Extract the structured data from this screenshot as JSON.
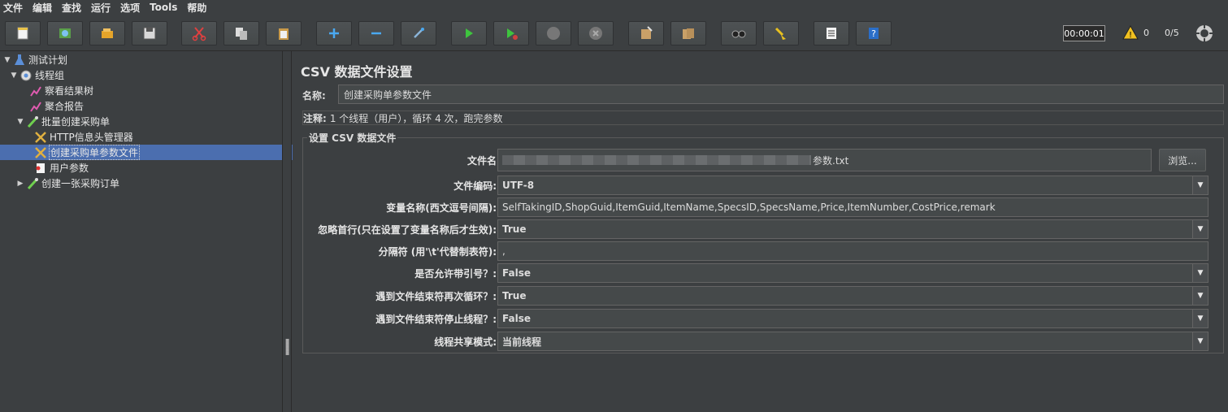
{
  "menu": [
    "文件",
    "编辑",
    "查找",
    "运行",
    "选项",
    "Tools",
    "帮助"
  ],
  "toolbar": {
    "buttons": [
      "new-icon",
      "templates-icon",
      "open-icon",
      "save-icon",
      "cut-icon",
      "copy-icon",
      "paste-icon",
      "expand-icon",
      "collapse-icon",
      "toggle-icon",
      "start-icon",
      "start-no-pause-icon",
      "stop-icon",
      "shutdown-icon",
      "clear-icon",
      "clear-all-icon",
      "search-icon",
      "reset-search-icon",
      "function-helper-icon",
      "help-icon"
    ],
    "timer": "00:00:01",
    "warnings": "0",
    "threads": "0/5"
  },
  "tree": [
    {
      "label": "测试计划",
      "icon": "test-plan-icon",
      "toggle": "▼"
    },
    {
      "label": "线程组",
      "icon": "thread-group-icon",
      "toggle": "▼"
    },
    {
      "label": "察看结果树",
      "icon": "listener-icon",
      "toggle": ""
    },
    {
      "label": "聚合报告",
      "icon": "listener-icon",
      "toggle": ""
    },
    {
      "label": "批量创建采购单",
      "icon": "sampler-icon",
      "toggle": "▼"
    },
    {
      "label": "HTTP信息头管理器",
      "icon": "config-icon",
      "toggle": ""
    },
    {
      "label": "创建采购单参数文件",
      "icon": "config-icon",
      "toggle": ""
    },
    {
      "label": "用户参数",
      "icon": "preprocessor-icon",
      "toggle": ""
    },
    {
      "label": "创建一张采购订单",
      "icon": "sampler-icon",
      "toggle": "▶"
    }
  ],
  "panel": {
    "title": "CSV 数据文件设置",
    "name_label": "名称:",
    "name_value": "创建采购单参数文件",
    "comment_label": "注释:",
    "comment_value": "1 个线程（用户），循环 4 次，跑完参数",
    "group_title": "设置 CSV 数据文件",
    "filename_label": "文件名",
    "filename_suffix": "参数.txt",
    "browse_label": "浏览...",
    "encoding_label": "文件编码:",
    "encoding_value": "UTF-8",
    "varnames_label": "变量名称(西文逗号间隔):",
    "varnames_value": "SelfTakingID,ShopGuid,ItemGuid,ItemName,SpecsID,SpecsName,Price,ItemNumber,CostPrice,remark",
    "ignore_label": "忽略首行(只在设置了变量名称后才生效):",
    "ignore_value": "True",
    "delim_label": "分隔符 (用'\\t'代替制表符):",
    "delim_value": ",",
    "quoted_label": "是否允许带引号？:",
    "quoted_value": "False",
    "recycle_label": "遇到文件结束符再次循环？:",
    "recycle_value": "True",
    "stop_label": "遇到文件结束符停止线程？:",
    "stop_value": "False",
    "share_label": "线程共享模式:",
    "share_value": "当前线程"
  }
}
